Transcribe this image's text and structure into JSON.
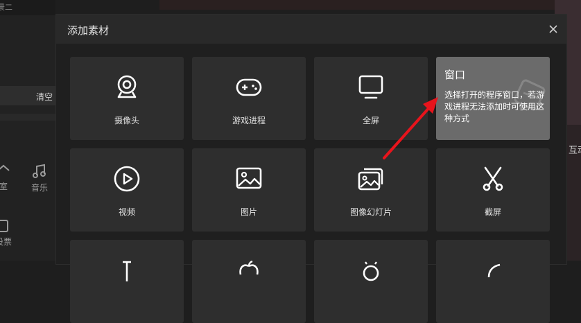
{
  "background": {
    "top_fragment": "景二",
    "clear_label": "清空",
    "nav": [
      {
        "label": "室",
        "icon": "home-icon"
      },
      {
        "label": "音乐",
        "icon": "music-icon"
      },
      {
        "label": "设票",
        "icon": "ticket-icon"
      }
    ],
    "right_fragment": "互动"
  },
  "dialog": {
    "title": "添加素材",
    "close_icon": "close-icon",
    "tiles": [
      {
        "label": "摄像头",
        "icon": "camera-icon"
      },
      {
        "label": "游戏进程",
        "icon": "gamepad-icon"
      },
      {
        "label": "全屏",
        "icon": "monitor-icon"
      },
      {
        "label": "窗口",
        "icon": "window-icon",
        "active": true,
        "description": "选择打开的程序窗口，若游戏进程无法添加时可使用这种方式"
      },
      {
        "label": "视频",
        "icon": "play-icon"
      },
      {
        "label": "图片",
        "icon": "image-icon"
      },
      {
        "label": "图像幻灯片",
        "icon": "slideshow-icon"
      },
      {
        "label": "截屏",
        "icon": "scissors-icon"
      }
    ]
  },
  "colors": {
    "annotation_arrow": "#e8141c",
    "active_tile": "#6b6b6b",
    "tile": "#2e2e2e"
  }
}
